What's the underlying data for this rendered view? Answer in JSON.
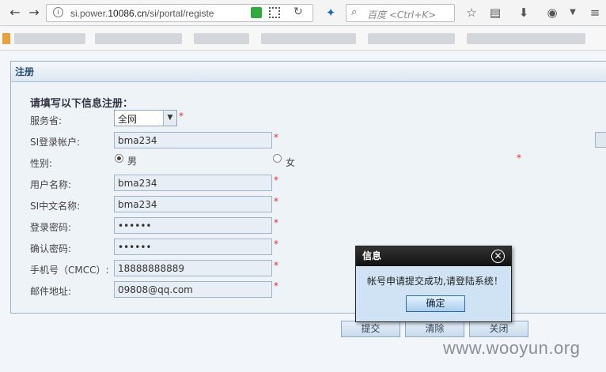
{
  "browser": {
    "url_prefix": "si.power.",
    "url_host": "10086.cn",
    "url_path": "/si/portal/registe",
    "search_placeholder": "百度 <Ctrl+K>"
  },
  "panel": {
    "title": "注册"
  },
  "form": {
    "heading": "请填写以下信息注册：",
    "province_label": "服务省:",
    "province_value": "全网",
    "account_label": "SI登录帐户:",
    "account_value": "bma234",
    "gender_label": "性别:",
    "gender_male": "男",
    "gender_female": "女",
    "gender_selected": "男",
    "username_label": "用户名称:",
    "username_value": "bma234",
    "cn_name_label": "SI中文名称:",
    "cn_name_value": "bma234",
    "password_label": "登录密码:",
    "password_value": "••••••",
    "confirm_label": "确认密码:",
    "confirm_value": "••••••",
    "phone_label": "手机号（CMCC）:",
    "phone_value": "18888888889",
    "email_label": "邮件地址:",
    "email_value": "09808@qq.com",
    "required_mark": "*"
  },
  "buttons": {
    "submit": "提交",
    "clear": "清除",
    "close": "关闭"
  },
  "dialog": {
    "title": "信息",
    "message": "帐号申请提交成功,请登陆系统！",
    "ok": "确定",
    "close_glyph": "✕"
  },
  "watermark": "www.wooyun.org",
  "colors": {
    "accent": "#2a4c6f",
    "required": "#e03030"
  }
}
